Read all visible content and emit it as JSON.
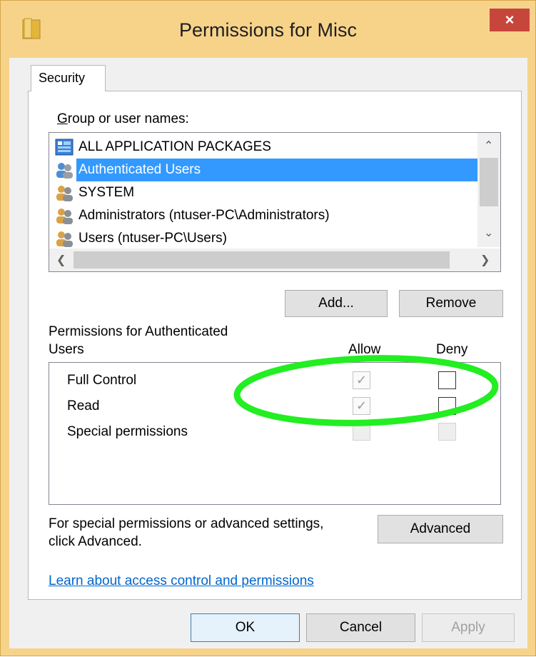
{
  "window": {
    "title": "Permissions for Misc",
    "close_label": "×"
  },
  "tabs": [
    {
      "label": "Security"
    }
  ],
  "groups": {
    "label": "Group or user names:",
    "items": [
      {
        "label": "ALL APPLICATION PACKAGES",
        "icon": "app-packages-icon",
        "selected": false
      },
      {
        "label": "Authenticated Users",
        "icon": "users-group-icon",
        "selected": true
      },
      {
        "label": "SYSTEM",
        "icon": "users-group-icon",
        "selected": false
      },
      {
        "label": "Administrators (ntuser-PC\\Administrators)",
        "icon": "users-group-icon",
        "selected": false
      },
      {
        "label": "Users (ntuser-PC\\Users)",
        "icon": "users-group-icon",
        "selected": false
      }
    ]
  },
  "buttons": {
    "add": "Add...",
    "remove": "Remove",
    "advanced": "Advanced",
    "ok": "OK",
    "cancel": "Cancel",
    "apply": "Apply"
  },
  "permissions": {
    "label_line1": "Permissions for Authenticated",
    "label_line2": "Users",
    "allow_header": "Allow",
    "deny_header": "Deny",
    "rows": [
      {
        "name": "Full Control",
        "allow": true,
        "deny": false
      },
      {
        "name": "Read",
        "allow": true,
        "deny": false
      },
      {
        "name": "Special permissions",
        "allow": false,
        "deny": false
      }
    ]
  },
  "advanced_text": {
    "line1": "For special permissions or advanced settings,",
    "line2": "click Advanced."
  },
  "learn_link": "Learn about access control and permissions",
  "colors": {
    "titlebar": "#f7d38a",
    "selection": "#3399ff",
    "close_button": "#c7463c",
    "link": "#0066cc",
    "annotation_ellipse": "#22ee22"
  }
}
